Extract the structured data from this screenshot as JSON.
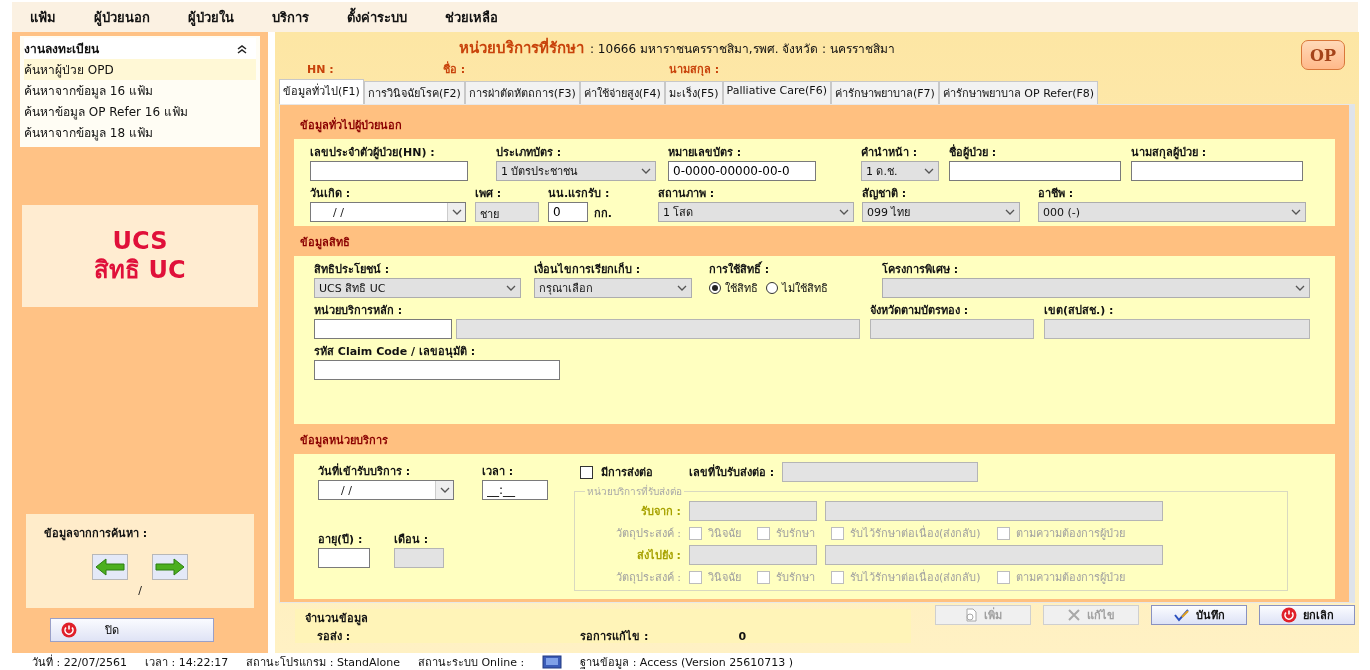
{
  "menu": [
    {
      "label": "แฟ้ม"
    },
    {
      "label": "ผู้ป่วยนอก"
    },
    {
      "label": "ผู้ป่วยใน"
    },
    {
      "label": "บริการ"
    },
    {
      "label": "ตั้งค่าระบบ"
    },
    {
      "label": "ช่วยเหลือ"
    }
  ],
  "sidebar": {
    "panel_title": "งานลงทะเบียน",
    "expanded": true,
    "items": [
      {
        "label": "ค้นหาผู้ป่วย OPD",
        "selected": true
      },
      {
        "label": "ค้นหาจากข้อมูล 16 แฟ้ม",
        "selected": false
      },
      {
        "label": "ค้นหาข้อมูล OP Refer 16 แฟ้ม",
        "selected": false
      },
      {
        "label": "ค้นหาจากข้อมูล 18 แฟ้ม",
        "selected": false
      }
    ],
    "rights_badge": [
      "UCS",
      "สิทธิ UC"
    ],
    "search_results": {
      "label": "ข้อมูลจากการค้นหา :",
      "position": "/"
    },
    "close_button": "ปิด"
  },
  "header": {
    "unit_label": "หน่วยบริการที่รักษา",
    "unit_value": ": 10666 มหาราชนครราชสิมา,รพศ.  จังหวัด : นครราชสิมา",
    "hn_label": "HN :",
    "name_label": "ชื่อ :",
    "surname_label": "นามสกุล :",
    "badge": "OP"
  },
  "tabs": [
    {
      "label": "ข้อมูลทั่วไป(F1)",
      "selected": true
    },
    {
      "label": "การวินิจฉัยโรค(F2)",
      "selected": false
    },
    {
      "label": "การผ่าตัดหัตถการ(F3)",
      "selected": false
    },
    {
      "label": "ค่าใช้จ่ายสูง(F4)",
      "selected": false
    },
    {
      "label": "มะเร็ง(F5)",
      "selected": false
    },
    {
      "label": "Palliative Care(F6)",
      "selected": false
    },
    {
      "label": "ค่ารักษาพยาบาล(F7)",
      "selected": false
    },
    {
      "label": "ค่ารักษาพยาบาล OP Refer(F8)",
      "selected": false
    }
  ],
  "general": {
    "title": "ข้อมูลทั่วไปผู้ป่วยนอก",
    "fields": [
      {
        "label": "เลขประจำตัวผู้ป่วย(HN) :",
        "kind": "text"
      },
      {
        "label": "ประเภทบัตร :",
        "kind": "select",
        "value": "1 บัตรประชาชน"
      },
      {
        "label": "หมายเลขบัตร :",
        "kind": "text",
        "value": "0-0000-00000-00-0"
      },
      {
        "label": "คำนำหน้า :",
        "kind": "select",
        "value": "1 ด.ช."
      },
      {
        "label": "ชื่อผู้ป่วย :",
        "kind": "text"
      },
      {
        "label": "นามสกุลผู้ป่วย :",
        "kind": "text"
      },
      {
        "label": "วันเกิด :",
        "kind": "date",
        "value": "/    /"
      },
      {
        "label": "เพศ :",
        "kind": "readonly",
        "value": "ชาย"
      },
      {
        "label": "นน.แรกรับ :",
        "kind": "unit",
        "value": "0",
        "unit": "กก."
      },
      {
        "label": "สถานภาพ :",
        "kind": "select",
        "value": "1 โสด"
      },
      {
        "label": "สัญชาติ :",
        "kind": "select",
        "value": "099 ไทย"
      },
      {
        "label": "อาชีพ :",
        "kind": "select",
        "value": "000 (-)"
      }
    ]
  },
  "rights": {
    "title": "ข้อมูลสิทธิ",
    "fields": [
      {
        "label": "สิทธิประโยชน์ :",
        "kind": "select",
        "value": "UCS สิทธิ UC"
      },
      {
        "label": "เงื่อนไขการเรียกเก็บ :",
        "kind": "select",
        "value": "กรุณาเลือก"
      },
      {
        "label": "การใช้สิทธิ์ :",
        "kind": "radio",
        "options": [
          {
            "label": "ใช้สิทธิ",
            "selected": true
          },
          {
            "label": "ไม่ใช้สิทธิ",
            "selected": false
          }
        ]
      },
      {
        "label": "โครงการพิเศษ :",
        "kind": "select"
      },
      {
        "label": "หน่วยบริการหลัก :",
        "kind": "pair"
      },
      {
        "label": "จังหวัดตามบัตรทอง :",
        "kind": "readonly"
      },
      {
        "label": "เขต(สปสช.) :",
        "kind": "readonly"
      },
      {
        "label": "รหัส Claim Code / เลขอนุมัติ :",
        "kind": "text"
      }
    ]
  },
  "service": {
    "title": "ข้อมูลหน่วยบริการ",
    "entry_date": {
      "label": "วันที่เข้ารับบริการ :",
      "value": "/    /"
    },
    "time": {
      "label": "เวลา :",
      "value": "__:__"
    },
    "age": {
      "label": "อายุ(ปี) :"
    },
    "month": {
      "label": "เดือน :"
    },
    "referral": {
      "label": "มีการส่งต่อ",
      "checked": false
    },
    "referral_no": {
      "label": "เลขที่ใบรับส่งต่อ :"
    },
    "referral_group": {
      "title": "หน่วยบริการที่รับส่งต่อ",
      "disabled": true,
      "rows": [
        {
          "label": "รับจาก :",
          "purpose_label": "วัตถุประสงค์ :",
          "purposes": [
            {
              "label": "วินิจฉัย",
              "checked": false
            },
            {
              "label": "รับรักษา",
              "checked": false
            },
            {
              "label": "รับไว้รักษาต่อเนื่อง(ส่งกลับ)",
              "checked": false
            },
            {
              "label": "ตามความต้องการผู้ป่วย",
              "checked": false
            }
          ]
        },
        {
          "label": "ส่งไปยัง :",
          "purpose_label": "วัตถุประสงค์ :",
          "purposes": [
            {
              "label": "วินิจฉัย",
              "checked": false
            },
            {
              "label": "รับรักษา",
              "checked": false
            },
            {
              "label": "รับไว้รักษาต่อเนื่อง(ส่งกลับ)",
              "checked": false
            },
            {
              "label": "ตามความต้องการผู้ป่วย",
              "checked": false
            }
          ]
        }
      ]
    }
  },
  "counts": {
    "title": "จำนวนข้อมูล",
    "pending_label": "รอส่ง :",
    "edit_label": "รอการแก้ไข :",
    "edit_value": "0"
  },
  "actions": [
    {
      "label": "เพิ่ม",
      "kind": "add",
      "disabled": true
    },
    {
      "label": "แก้ไข",
      "kind": "edit",
      "disabled": true
    },
    {
      "label": "บันทึก",
      "kind": "save",
      "disabled": false
    },
    {
      "label": "ยกเลิก",
      "kind": "cancel",
      "disabled": false
    }
  ],
  "status_bar": {
    "date": "วันที่ : 22/07/2561",
    "time": "เวลา : 14:22:17",
    "program": "สถานะโปรแกรม : StandAlone",
    "online": "สถานะระบบ Online :",
    "database": "ฐานข้อมูล : Access (Version 25610713 )"
  }
}
